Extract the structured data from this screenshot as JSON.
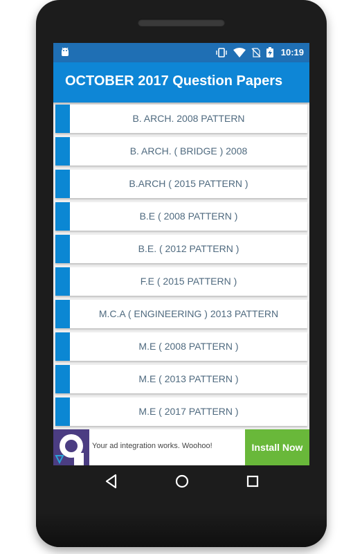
{
  "status_bar": {
    "time": "10:19",
    "icons": [
      "vibrate-icon",
      "wifi-icon",
      "no-sim-icon",
      "battery-charging-icon"
    ]
  },
  "app_bar": {
    "title": "OCTOBER 2017 Question Papers"
  },
  "list": {
    "items": [
      {
        "label": "B. ARCH.  2008 PATTERN"
      },
      {
        "label": "B. ARCH. ( BRIDGE ) 2008"
      },
      {
        "label": "B.ARCH ( 2015 PATTERN )"
      },
      {
        "label": "B.E ( 2008 PATTERN )"
      },
      {
        "label": "B.E. ( 2012 PATTERN )"
      },
      {
        "label": "F.E ( 2015 PATTERN )"
      },
      {
        "label": "M.C.A ( ENGINEERING ) 2013 PATTERN"
      },
      {
        "label": "M.E ( 2008 PATTERN )"
      },
      {
        "label": "M.E ( 2013 PATTERN )"
      },
      {
        "label": "M.E ( 2017 PATTERN )"
      }
    ]
  },
  "ad": {
    "text": "Your ad integration works. Woohoo!",
    "button_label": "Install Now"
  },
  "colors": {
    "status_bar": "#1f6fb4",
    "app_bar": "#0e86d6",
    "list_accent": "#0b87d3",
    "ad_button": "#69b83a"
  }
}
